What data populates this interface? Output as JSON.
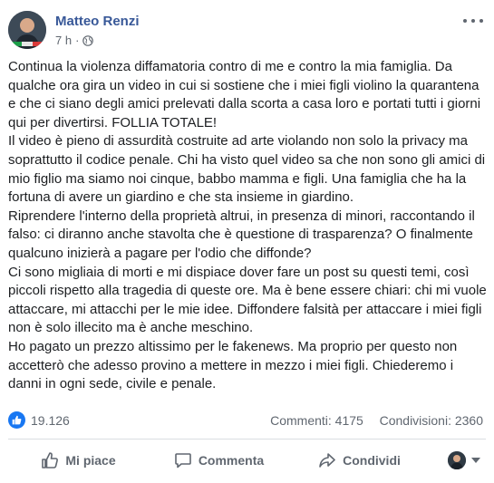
{
  "post": {
    "author": "Matteo Renzi",
    "time": "7 h",
    "separator": "·",
    "paragraphs": [
      "Continua la violenza diffamatoria contro di me e contro la mia famiglia. Da qualche ora gira un video in cui si sostiene che i miei figli violino la quarantena e che ci siano degli amici prelevati dalla scorta a casa loro e portati tutti i giorni qui per divertirsi. FOLLIA TOTALE!",
      "Il video è pieno di assurdità costruite ad arte violando non solo la privacy ma soprattutto il codice penale. Chi ha visto quel video sa che non sono gli amici di mio figlio ma siamo noi cinque, babbo mamma e figli. Una famiglia che ha la fortuna di avere un giardino e che sta insieme in giardino.",
      "Riprendere l'interno della proprietà altrui, in presenza di minori, raccontando il falso: ci diranno anche stavolta che è questione di trasparenza? O finalmente qualcuno inizierà a pagare per l'odio che diffonde?",
      "Ci sono migliaia di morti e mi dispiace dover fare un post su questi temi, così piccoli rispetto alla tragedia di queste ore. Ma è bene essere chiari: chi mi vuole attaccare, mi attacchi per le mie idee. Diffondere falsità per attaccare i miei figli non è solo illecito ma è anche meschino.",
      "Ho pagato un prezzo altissimo per le fakenews. Ma proprio per questo non accetterò che adesso provino a mettere in mezzo i miei figli. Chiederemo i danni in ogni sede, civile e penale."
    ]
  },
  "stats": {
    "reactions": "19.126",
    "comments": "Commenti: 4175",
    "shares": "Condivisioni: 2360"
  },
  "actions": {
    "like": "Mi piace",
    "comment": "Commenta",
    "share": "Condividi"
  },
  "icons": {
    "like": "thumbs-up-icon",
    "comment": "speech-bubble-icon",
    "share": "share-arrow-icon",
    "privacy": "globe-icon",
    "menu": "more-dots-icon"
  },
  "colors": {
    "author": "#385898",
    "like_badge": "#1877f2",
    "secondary_text": "#606770"
  }
}
